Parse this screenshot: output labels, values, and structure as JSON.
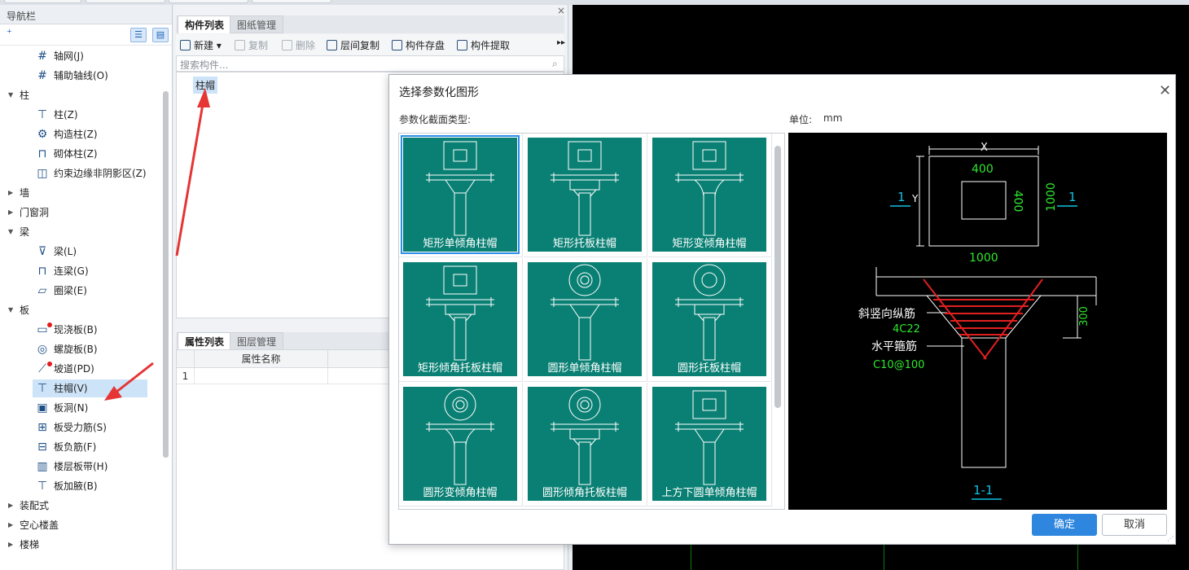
{
  "nav": {
    "title": "导航栏",
    "items": [
      {
        "label": "轴网(J)",
        "icon": "grid-icon"
      },
      {
        "label": "辅助轴线(O)",
        "icon": "grid-icon"
      },
      {
        "label": "柱",
        "group": true
      },
      {
        "label": "柱(Z)",
        "icon": "column-icon"
      },
      {
        "label": "构造柱(Z)",
        "icon": "gear-column-icon"
      },
      {
        "label": "砌体柱(Z)",
        "icon": "masonry-column-icon"
      },
      {
        "label": "约束边缘非阴影区(Z)",
        "icon": "edge-zone-icon"
      },
      {
        "label": "墙",
        "group": true
      },
      {
        "label": "门窗洞",
        "group": true
      },
      {
        "label": "梁",
        "group": true
      },
      {
        "label": "梁(L)",
        "icon": "beam-icon"
      },
      {
        "label": "连梁(G)",
        "icon": "link-beam-icon"
      },
      {
        "label": "圈梁(E)",
        "icon": "ring-beam-icon"
      },
      {
        "label": "板",
        "group": true
      },
      {
        "label": "现浇板(B)",
        "icon": "slab-icon"
      },
      {
        "label": "螺旋板(B)",
        "icon": "spiral-slab-icon"
      },
      {
        "label": "坡道(PD)",
        "icon": "ramp-icon"
      },
      {
        "label": "柱帽(V)",
        "icon": "column-cap-icon"
      },
      {
        "label": "板洞(N)",
        "icon": "slab-hole-icon"
      },
      {
        "label": "板受力筋(S)",
        "icon": "slab-rebar-icon"
      },
      {
        "label": "板负筋(F)",
        "icon": "negative-rebar-icon"
      },
      {
        "label": "楼层板带(H)",
        "icon": "slab-strip-icon"
      },
      {
        "label": "板加腋(B)",
        "icon": "slab-haunch-icon"
      },
      {
        "label": "装配式",
        "group": true
      },
      {
        "label": "空心楼盖",
        "group": true
      },
      {
        "label": "楼梯",
        "group": true
      }
    ]
  },
  "middle": {
    "tabs_top": [
      "构件列表",
      "图纸管理"
    ],
    "toolbar": [
      "新建",
      "复制",
      "删除",
      "层间复制",
      "构件存盘",
      "构件提取"
    ],
    "search_placeholder": "搜索构件...",
    "component": "柱帽",
    "tabs_bottom": [
      "属性列表",
      "图层管理"
    ],
    "prop_header": "属性名称",
    "row_number": "1"
  },
  "dialog": {
    "title": "选择参数化图形",
    "type_label": "参数化截面类型:",
    "unit_label": "单位:",
    "unit_value": "mm",
    "shapes": [
      "矩形单倾角柱帽",
      "矩形托板柱帽",
      "矩形变倾角柱帽",
      "矩形倾角托板柱帽",
      "圆形单倾角柱帽",
      "圆形托板柱帽",
      "圆形变倾角柱帽",
      "圆形倾角托板柱帽",
      "上方下圆单倾角柱帽"
    ],
    "ok": "确定",
    "cancel": "取消",
    "preview": {
      "dim_x": "X",
      "dim_y": "Y",
      "dim_inner_w": "400",
      "dim_inner_h": "400",
      "dim_outer_h": "1000",
      "dim_outer_w": "1000",
      "section_mark": "1",
      "label_slant": "斜竖向纵筋",
      "label_slant_spec": "4C22",
      "label_stirrup": "水平箍筋",
      "label_stirrup_spec": "C10@100",
      "dim_300": "300",
      "section_title": "1-1"
    }
  },
  "colors": {
    "thumb": "#0a8074",
    "accent": "#2e86de",
    "selection": "#cde3f8"
  }
}
